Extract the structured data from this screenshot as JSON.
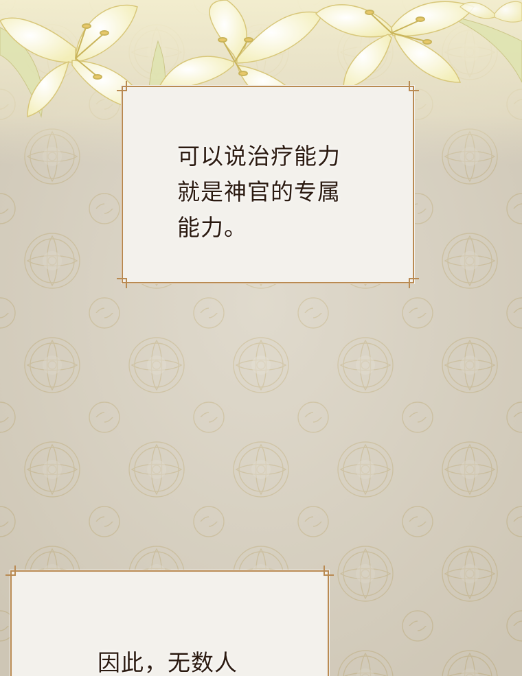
{
  "panels": [
    {
      "lines": [
        "可以说治疗能力",
        "就是神官的专属",
        "能力。"
      ]
    },
    {
      "lines": [
        "因此，无数人"
      ]
    }
  ],
  "colors": {
    "background": "#d8d1c0",
    "panel_fill": "#f3f1ec",
    "frame_gold": "#b98a52",
    "text": "#2b1a10",
    "lily": "#fbf7d6"
  },
  "decor": {
    "top_border": "white-lily-flowers",
    "background_pattern": "ornamental-damask"
  }
}
